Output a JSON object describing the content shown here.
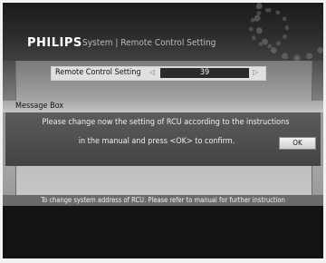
{
  "header": {
    "brand": "PHILIPS",
    "breadcrumb": "System | Remote Control Setting"
  },
  "setting": {
    "label": "Remote Control Setting",
    "value": "39",
    "left_arrow": "◁",
    "right_arrow": "▷"
  },
  "message_box": {
    "title": "Message Box",
    "line1": "Please change now the setting of RCU according to the instructions",
    "line2": "in the manual and press <OK> to confirm.",
    "ok_label": "OK"
  },
  "footer": {
    "hint": "To change system address of RCU. Please refer to manual for further instruction"
  }
}
